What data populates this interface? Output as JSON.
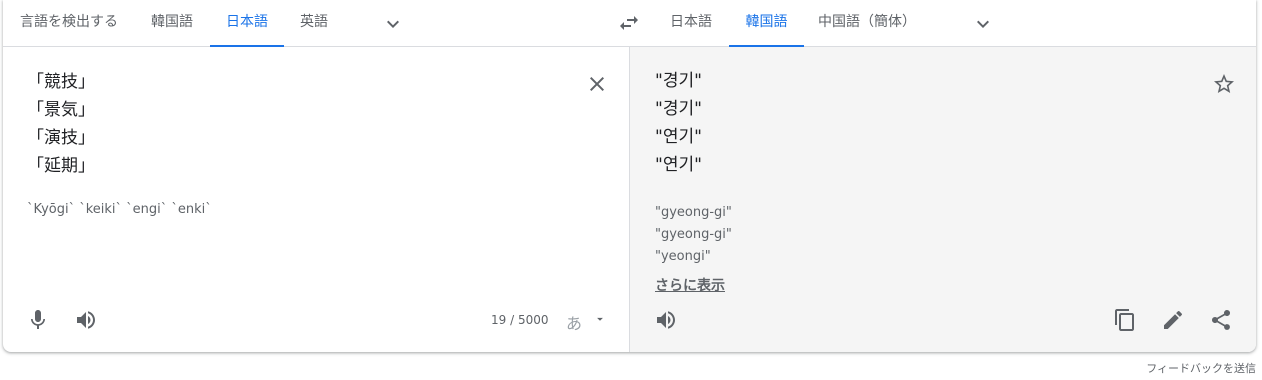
{
  "source_languages": {
    "tabs": [
      {
        "label": "言語を検出する",
        "active": false
      },
      {
        "label": "韓国語",
        "active": false
      },
      {
        "label": "日本語",
        "active": true
      },
      {
        "label": "英語",
        "active": false
      }
    ]
  },
  "target_languages": {
    "tabs": [
      {
        "label": "日本語",
        "active": false
      },
      {
        "label": "韓国語",
        "active": true
      },
      {
        "label": "中国語（簡体）",
        "active": false
      }
    ]
  },
  "source": {
    "lines": [
      "「競技」",
      "「景気」",
      "「演技」",
      "「延期」"
    ],
    "romanization": "`Kyōgi` `keiki` `engi` `enki`",
    "char_count": "19 / 5000",
    "ime_label": "あ"
  },
  "target": {
    "lines": [
      "\"경기\"",
      "\"경기\"",
      "\"연기\"",
      "\"연기\""
    ],
    "romanization": [
      "\"gyeong-gi\"",
      "\"gyeong-gi\"",
      "\"yeongi\""
    ],
    "show_more": "さらに表示"
  },
  "feedback_label": "フィードバックを送信",
  "icons": {
    "dropdown": "chevron-down-icon",
    "swap": "swap-icon",
    "clear": "close-icon",
    "star": "star-icon",
    "mic": "mic-icon",
    "speaker": "speaker-icon",
    "copy": "copy-icon",
    "edit": "pencil-icon",
    "share": "share-icon"
  },
  "colors": {
    "accent": "#1a73e8",
    "text": "#202124",
    "secondary": "#5f6368",
    "target_bg": "#f5f5f5"
  }
}
